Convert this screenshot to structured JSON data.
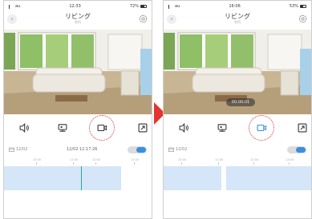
{
  "colors": {
    "accent": "#3b8fe0",
    "highlight": "#d0302a",
    "arrow": "#e3342f",
    "timeline_fill": "#d4e6f7",
    "cursor": "#2aa88f"
  },
  "screens": [
    {
      "status": {
        "carrier": "au",
        "time": "12:33",
        "battery": "72%"
      },
      "nav": {
        "title": "リビング",
        "subtitle": "宅内"
      },
      "date_row": {
        "label": "12/02",
        "value": "12/02 12:17:26"
      },
      "timeline_ticks": [
        "10:00",
        "11:00",
        "12:00",
        "13:00"
      ],
      "highlighted_control": "record-video-button"
    },
    {
      "status": {
        "carrier": "au",
        "time": "16:06",
        "battery": "53%"
      },
      "nav": {
        "title": "リビング",
        "subtitle": "宅内"
      },
      "recording_timer": "00:00:01",
      "date_row": {
        "label": "12/02"
      },
      "timeline_ticks": [
        "10:00",
        "11:00",
        "12:00",
        "13:00"
      ],
      "highlighted_control": "record-video-button",
      "record_active": true
    }
  ],
  "icons": [
    "back-icon",
    "gear-icon",
    "speaker-icon",
    "camera-switch-icon",
    "video-record-icon",
    "screenshot-icon",
    "calendar-icon"
  ]
}
